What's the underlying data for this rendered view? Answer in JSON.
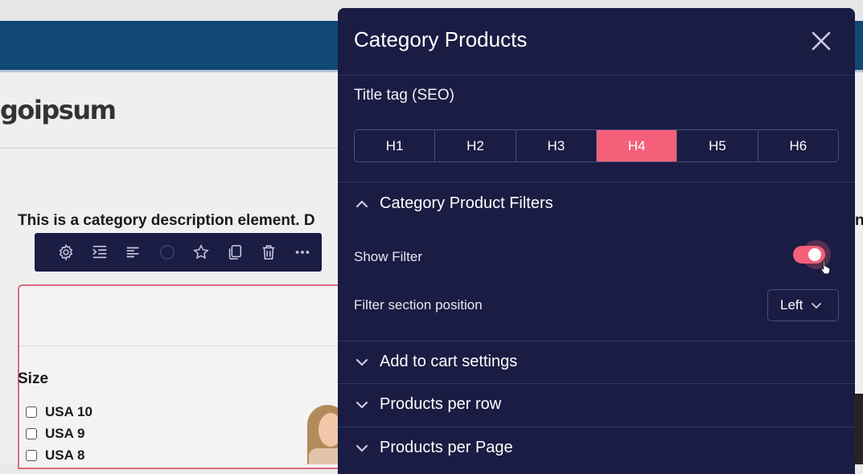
{
  "background": {
    "logo_text": "goipsum",
    "category_description": "This is a category description element. D",
    "category_description_tail": "n",
    "size_filter": {
      "title": "Size",
      "options": [
        "USA 10",
        "USA 9",
        "USA 8"
      ]
    },
    "toolbar_icons": [
      "gear-icon",
      "indent-icon",
      "align-left-icon",
      "circle-icon",
      "star-icon",
      "copy-icon",
      "trash-icon",
      "more-icon"
    ]
  },
  "panel": {
    "title": "Category Products",
    "close_icon": "close-icon",
    "title_tag": {
      "label": "Title tag (SEO)",
      "options": [
        "H1",
        "H2",
        "H3",
        "H4",
        "H5",
        "H6"
      ],
      "selected": "H4"
    },
    "filters_section": {
      "title": "Category Product Filters",
      "expanded": true,
      "show_filter_label": "Show Filter",
      "show_filter_on": true,
      "position_label": "Filter section position",
      "position_value": "Left"
    },
    "collapsed_sections": [
      "Add to cart settings",
      "Products per row",
      "Products per Page"
    ]
  },
  "colors": {
    "panel_bg": "#1a1c43",
    "accent": "#f4607a",
    "header_blue": "#0f4775"
  }
}
